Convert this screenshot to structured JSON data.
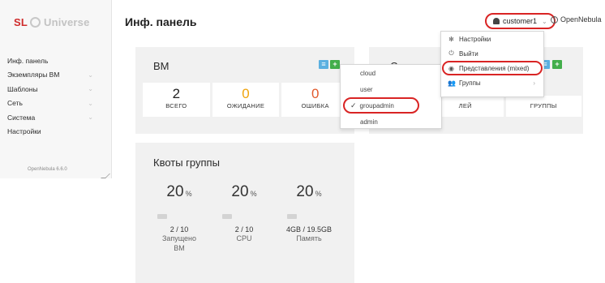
{
  "sidebar": {
    "brand_sl": "SL",
    "brand_name": "Universe",
    "items": [
      {
        "label": "Инф. панель",
        "has_submenu": false
      },
      {
        "label": "Экземпляры ВМ",
        "has_submenu": true
      },
      {
        "label": "Шаблоны",
        "has_submenu": true
      },
      {
        "label": "Сеть",
        "has_submenu": true
      },
      {
        "label": "Система",
        "has_submenu": true
      },
      {
        "label": "Настройки",
        "has_submenu": false
      }
    ],
    "version": "OpenNebula 6.6.0"
  },
  "header": {
    "title": "Инф. панель",
    "user": "customer1",
    "zone": "OpenNebula"
  },
  "vm_card": {
    "title": "ВМ",
    "stats": [
      {
        "value": "2",
        "label": "ВСЕГО",
        "color": "#222222"
      },
      {
        "value": "0",
        "label": "ОЖИДАНИЕ",
        "color": "#f0a30a"
      },
      {
        "value": "0",
        "label": "ОШИБКА",
        "color": "#e25a2c"
      }
    ]
  },
  "system_card": {
    "title_partial": "Систем",
    "stats": [
      {
        "label": "ЛЕЙ"
      },
      {
        "label": "ГРУППЫ"
      }
    ]
  },
  "quota_card": {
    "title": "Квоты группы",
    "unit": "%",
    "items": [
      {
        "percent": "20",
        "value": "2 / 10",
        "label": "Запущено ВМ"
      },
      {
        "percent": "20",
        "value": "2 / 10",
        "label": "CPU"
      },
      {
        "percent": "20",
        "value": "4GB / 19.5GB",
        "label": "Память"
      }
    ]
  },
  "user_menu": {
    "items": [
      {
        "icon": "gear-icon",
        "label": "Настройки"
      },
      {
        "icon": "power-icon",
        "label": "Выйти"
      },
      {
        "icon": "eye-icon",
        "label": "Представления (mixed)"
      },
      {
        "icon": "users-icon",
        "label": "Группы"
      }
    ]
  },
  "views_menu": {
    "items": [
      {
        "label": "cloud",
        "checked": false
      },
      {
        "label": "user",
        "checked": false
      },
      {
        "label": "groupadmin",
        "checked": true
      },
      {
        "label": "admin",
        "checked": false
      }
    ]
  },
  "colors": {
    "highlight": "#d92424",
    "brand_red": "#cf2b2b",
    "add_button": "#43ae4b",
    "list_button": "#5bb0e0"
  }
}
